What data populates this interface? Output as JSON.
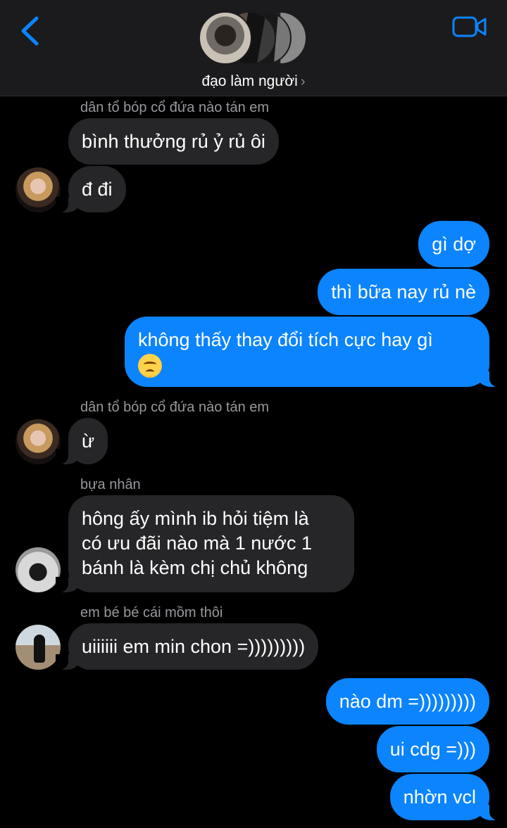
{
  "header": {
    "group_name": "đạo làm người",
    "chevron": "›",
    "back_icon": "chevron-left-icon",
    "video_icon": "video-camera-icon",
    "accent": "#0b84fe"
  },
  "messages": {
    "m1_sender": "dân tổ bóp cổ đứa nào tán em",
    "m1_a": "bình thưởng rủ ỷ rủ ôi",
    "m1_b": "đ đi",
    "m2_a": "gì dợ",
    "m2_b": "thì bữa nay rủ nè",
    "m2_c_line1": "không thấy thay đổi tích cực hay gì",
    "m3_sender": "dân tổ bóp cổ đứa nào tán em",
    "m3_a": "ừ",
    "m4_sender": "bựa nhân",
    "m4_line1": "hông ấy mình ib hỏi tiệm là",
    "m4_line2": "có ưu đãi nào mà 1 nước 1",
    "m4_line3": "bánh là kèm chị chủ không",
    "m5_sender": "em bé bé cái mồm thôi",
    "m5_a": "uiiiiii em min chon =)))))))))",
    "m6_a": "nào dm =)))))))))",
    "m6_b": "ui cdg =)))",
    "m6_c": "nhờn vcl"
  }
}
